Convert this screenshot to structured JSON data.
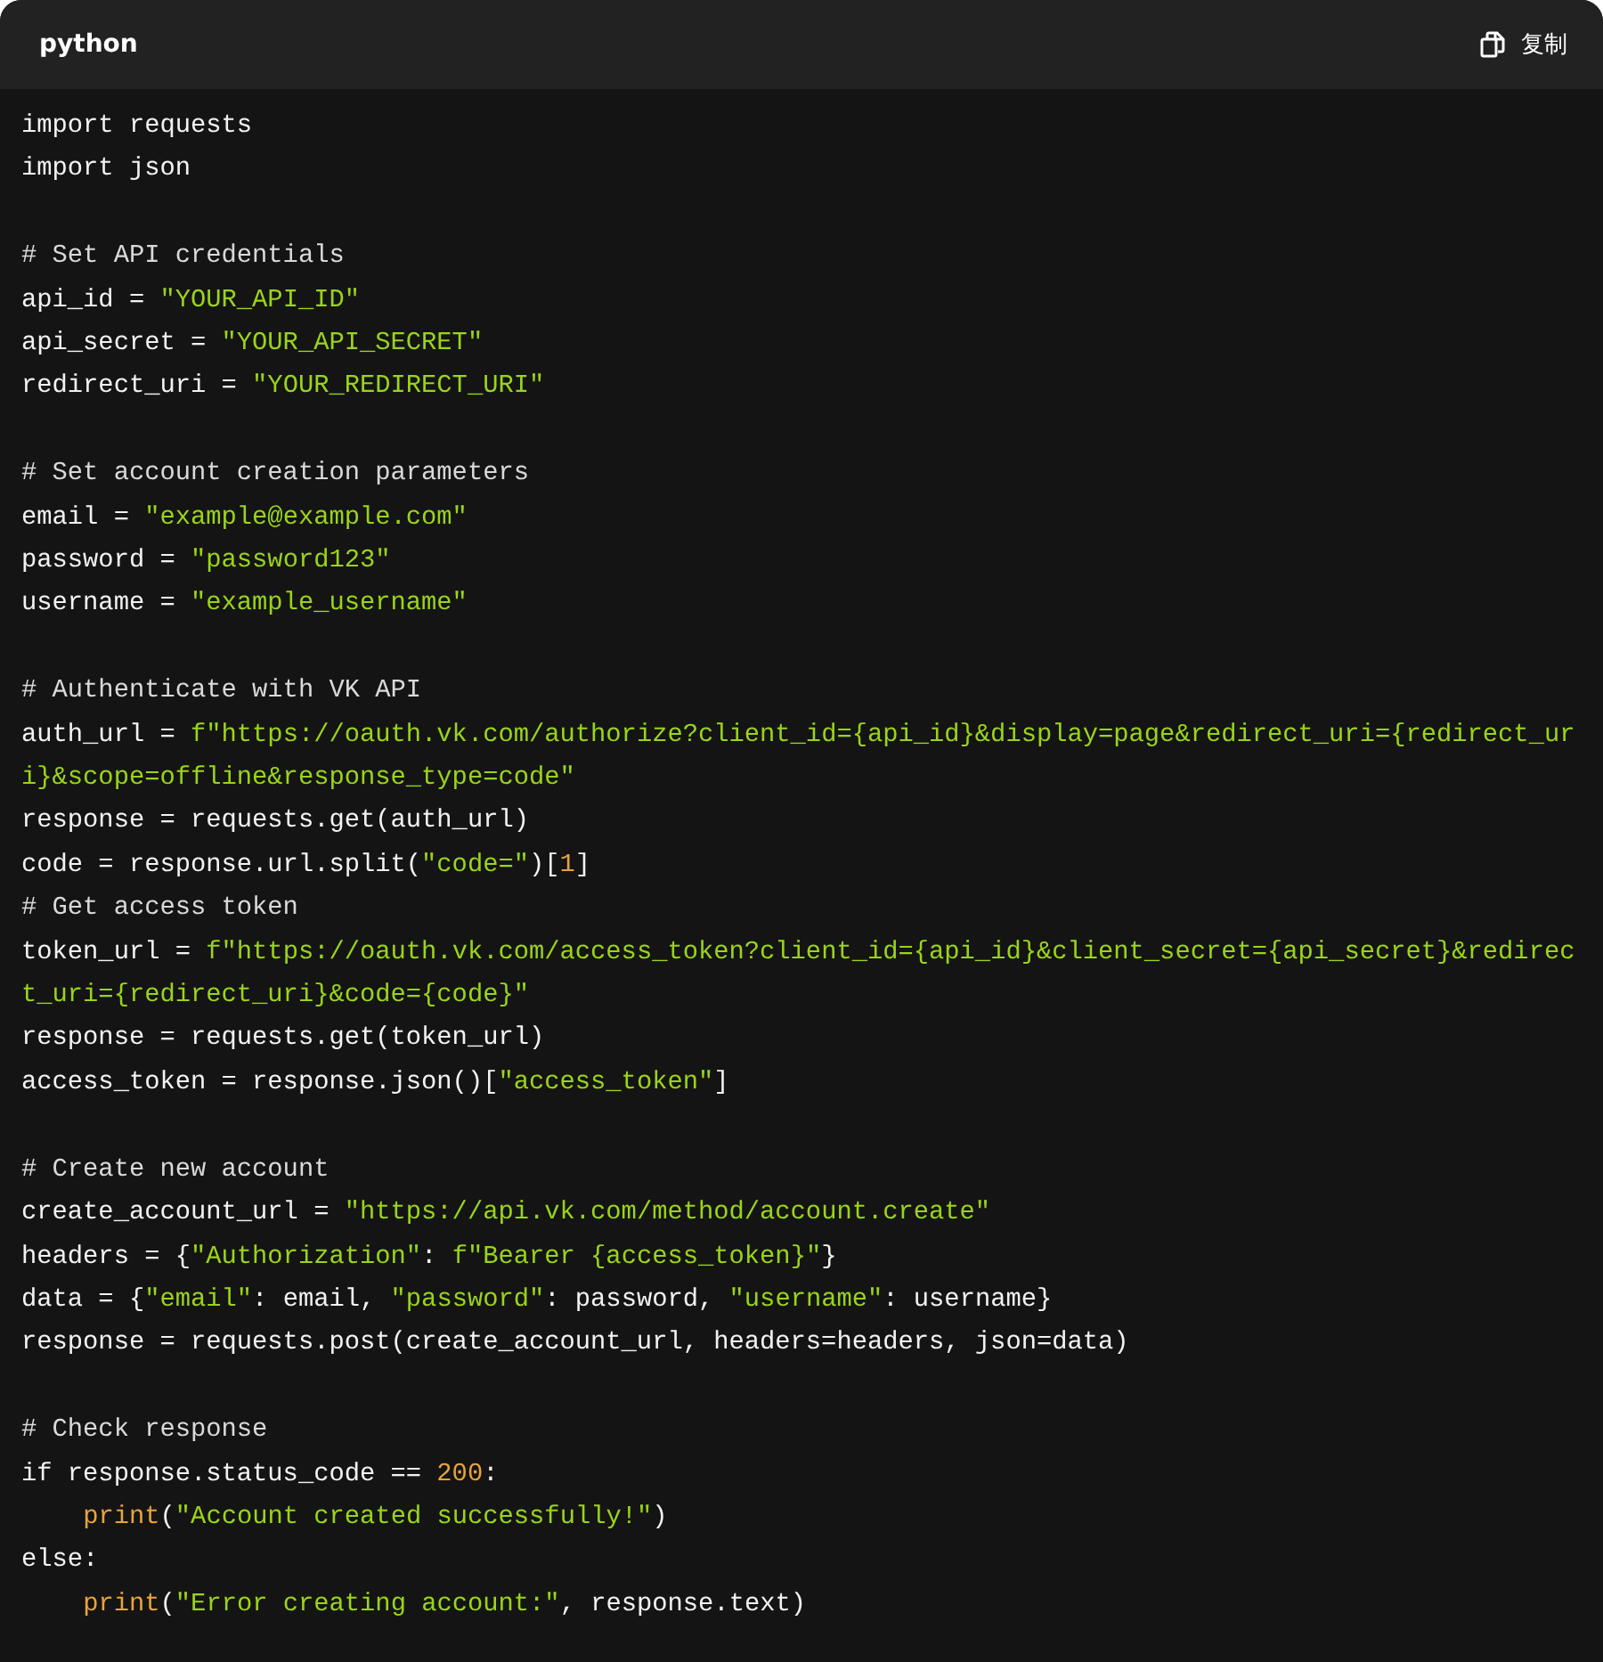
{
  "code_block": {
    "language": "python",
    "copy_label": "复制",
    "lines": [
      {
        "gap_before": false,
        "indented": false,
        "tokens": [
          {
            "kind": "plain",
            "text": "import requests"
          }
        ]
      },
      {
        "gap_before": false,
        "indented": false,
        "tokens": [
          {
            "kind": "plain",
            "text": "import json"
          }
        ]
      },
      {
        "gap_before": true,
        "indented": false,
        "tokens": [
          {
            "kind": "comment",
            "text": "# Set API credentials"
          }
        ]
      },
      {
        "gap_before": false,
        "indented": false,
        "tokens": [
          {
            "kind": "plain",
            "text": "api_id = "
          },
          {
            "kind": "string",
            "text": "\"YOUR_API_ID\""
          }
        ]
      },
      {
        "gap_before": false,
        "indented": false,
        "tokens": [
          {
            "kind": "plain",
            "text": "api_secret = "
          },
          {
            "kind": "string",
            "text": "\"YOUR_API_SECRET\""
          }
        ]
      },
      {
        "gap_before": false,
        "indented": false,
        "tokens": [
          {
            "kind": "plain",
            "text": "redirect_uri = "
          },
          {
            "kind": "string",
            "text": "\"YOUR_REDIRECT_URI\""
          }
        ]
      },
      {
        "gap_before": true,
        "indented": false,
        "tokens": [
          {
            "kind": "comment",
            "text": "# Set account creation parameters"
          }
        ]
      },
      {
        "gap_before": false,
        "indented": false,
        "tokens": [
          {
            "kind": "plain",
            "text": "email = "
          },
          {
            "kind": "string",
            "text": "\"example@example.com\""
          }
        ]
      },
      {
        "gap_before": false,
        "indented": false,
        "tokens": [
          {
            "kind": "plain",
            "text": "password = "
          },
          {
            "kind": "string",
            "text": "\"password123\""
          }
        ]
      },
      {
        "gap_before": false,
        "indented": false,
        "tokens": [
          {
            "kind": "plain",
            "text": "username = "
          },
          {
            "kind": "string",
            "text": "\"example_username\""
          }
        ]
      },
      {
        "gap_before": true,
        "indented": false,
        "tokens": [
          {
            "kind": "comment",
            "text": "# Authenticate with VK API"
          }
        ]
      },
      {
        "gap_before": false,
        "indented": false,
        "tokens": [
          {
            "kind": "plain",
            "text": "auth_url = "
          },
          {
            "kind": "string",
            "text": "f\"https://oauth.vk.com/authorize?client_id={api_id}&display=page&redirect_uri={redirect_uri}&scope=offline&response_type=code\""
          }
        ]
      },
      {
        "gap_before": false,
        "indented": false,
        "tokens": [
          {
            "kind": "plain",
            "text": "response = requests.get(auth_url)"
          }
        ]
      },
      {
        "gap_before": false,
        "indented": false,
        "tokens": [
          {
            "kind": "plain",
            "text": "code = response.url.split("
          },
          {
            "kind": "string",
            "text": "\"code=\""
          },
          {
            "kind": "plain",
            "text": ")["
          },
          {
            "kind": "number",
            "text": "1"
          },
          {
            "kind": "plain",
            "text": "]"
          }
        ]
      },
      {
        "gap_before": false,
        "indented": false,
        "tokens": [
          {
            "kind": "comment",
            "text": "# Get access token"
          }
        ]
      },
      {
        "gap_before": false,
        "indented": false,
        "tokens": [
          {
            "kind": "plain",
            "text": "token_url = "
          },
          {
            "kind": "string",
            "text": "f\"https://oauth.vk.com/access_token?client_id={api_id}&client_secret={api_secret}&redirect_uri={redirect_uri}&code={code}\""
          }
        ]
      },
      {
        "gap_before": false,
        "indented": false,
        "tokens": [
          {
            "kind": "plain",
            "text": "response = requests.get(token_url)"
          }
        ]
      },
      {
        "gap_before": false,
        "indented": false,
        "tokens": [
          {
            "kind": "plain",
            "text": "access_token = response.json()["
          },
          {
            "kind": "string",
            "text": "\"access_token\""
          },
          {
            "kind": "plain",
            "text": "]"
          }
        ]
      },
      {
        "gap_before": true,
        "indented": false,
        "tokens": [
          {
            "kind": "comment",
            "text": "# Create new account"
          }
        ]
      },
      {
        "gap_before": false,
        "indented": false,
        "tokens": [
          {
            "kind": "plain",
            "text": "create_account_url = "
          },
          {
            "kind": "string",
            "text": "\"https://api.vk.com/method/account.create\""
          }
        ]
      },
      {
        "gap_before": false,
        "indented": false,
        "tokens": [
          {
            "kind": "plain",
            "text": "headers = {"
          },
          {
            "kind": "string",
            "text": "\"Authorization\""
          },
          {
            "kind": "plain",
            "text": ": "
          },
          {
            "kind": "string",
            "text": "f\"Bearer {access_token}\""
          },
          {
            "kind": "plain",
            "text": "}"
          }
        ]
      },
      {
        "gap_before": false,
        "indented": false,
        "tokens": [
          {
            "kind": "plain",
            "text": "data = {"
          },
          {
            "kind": "string",
            "text": "\"email\""
          },
          {
            "kind": "plain",
            "text": ": email, "
          },
          {
            "kind": "string",
            "text": "\"password\""
          },
          {
            "kind": "plain",
            "text": ": password, "
          },
          {
            "kind": "string",
            "text": "\"username\""
          },
          {
            "kind": "plain",
            "text": ": username}"
          }
        ]
      },
      {
        "gap_before": false,
        "indented": false,
        "tokens": [
          {
            "kind": "plain",
            "text": "response = requests.post(create_account_url, headers=headers, json=data)"
          }
        ]
      },
      {
        "gap_before": true,
        "indented": false,
        "tokens": [
          {
            "kind": "comment",
            "text": "# Check response"
          }
        ]
      },
      {
        "gap_before": false,
        "indented": false,
        "tokens": [
          {
            "kind": "plain",
            "text": "if response.status_code == "
          },
          {
            "kind": "number",
            "text": "200"
          },
          {
            "kind": "plain",
            "text": ":"
          }
        ]
      },
      {
        "gap_before": false,
        "indented": true,
        "tokens": [
          {
            "kind": "builtin",
            "text": "print"
          },
          {
            "kind": "plain",
            "text": "("
          },
          {
            "kind": "string",
            "text": "\"Account created successfully!\""
          },
          {
            "kind": "plain",
            "text": ")"
          }
        ]
      },
      {
        "gap_before": false,
        "indented": false,
        "tokens": [
          {
            "kind": "plain",
            "text": "else:"
          }
        ]
      },
      {
        "gap_before": false,
        "indented": true,
        "tokens": [
          {
            "kind": "builtin",
            "text": "print"
          },
          {
            "kind": "plain",
            "text": "("
          },
          {
            "kind": "string",
            "text": "\"Error creating account:\""
          },
          {
            "kind": "plain",
            "text": ", response.text)"
          }
        ]
      }
    ]
  }
}
